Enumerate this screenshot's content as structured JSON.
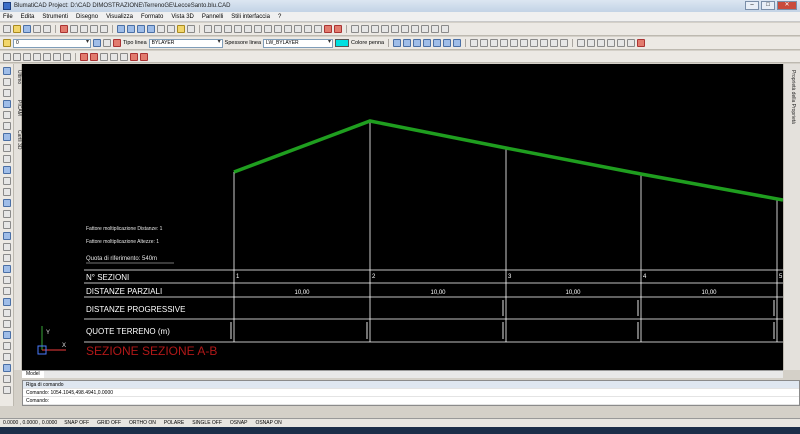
{
  "window": {
    "title": "BlumatiCAD Project: D:\\CAD DIMOSTRAZIONE\\TerrenoGE\\LecceSanto.blu.CAD"
  },
  "menu": [
    "File",
    "Edita",
    "Strumenti",
    "Disegno",
    "Visualizza",
    "Formato",
    "Vista 3D",
    "Pannelli",
    "Stili interfaccia",
    "?"
  ],
  "toolbar": {
    "layer_value": "0",
    "linetype_label": "Tipo linea",
    "linetype_value": "BYLAYER",
    "lineweight_label": "Spessore linea",
    "lineweight_value": "LW_BYLAYER",
    "pen_color_label": "Colore penna",
    "pen_color": "#00e0e0"
  },
  "left_tabs": [
    "Ultimo",
    "PICAM",
    "Cartli 3D"
  ],
  "right_tabs": [
    "Proprietà della Proprietà"
  ],
  "drawing": {
    "factors": [
      "Fattore moltiplicazione Distanze:   1",
      "Fattore moltiplicazione Altezze:   1"
    ],
    "reference": "Quota di riferimento: 540m",
    "rows": [
      "N° SEZIONI",
      "DISTANZE PARZIALI",
      "DISTANZE PROGRESSIVE",
      "QUOTE TERRENO (m)"
    ],
    "section_numbers": [
      "1",
      "2",
      "3",
      "4",
      "5"
    ],
    "partial_distances": [
      "10,00",
      "10,00",
      "10,00",
      "10,00"
    ],
    "title": "SEZIONE SEZIONE A-B",
    "profile_color": "#1f9e1f",
    "title_color": "#b01818"
  },
  "tabs": {
    "model": "Model"
  },
  "command": {
    "header": "Riga di comando",
    "history": "Comando: 1054.1045,498.4941,0.0000",
    "prompt": "Comando:"
  },
  "status": {
    "coords": "0.0000 , 0.0000 , 0.0000",
    "items": [
      "SNAP OFF",
      "GRID OFF",
      "ORTHO ON",
      "POLARE",
      "SINGLE OFF",
      "OSNAP",
      "OSNAP ON"
    ]
  }
}
